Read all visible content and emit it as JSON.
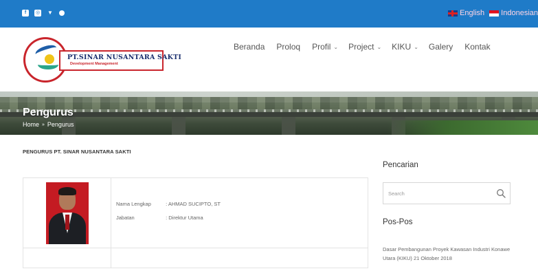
{
  "topbar": {
    "socials": [
      "facebook-icon",
      "instagram-icon",
      "twitter-icon",
      "dribbble-icon"
    ],
    "languages": [
      {
        "label": "English",
        "flag": "uk-flag-icon"
      },
      {
        "label": "Indonesian",
        "flag": "id-flag-icon"
      }
    ]
  },
  "brand": {
    "name": "PT.SINAR NUSANTARA SAKTI",
    "tagline": "Development Management"
  },
  "nav": {
    "items": [
      {
        "label": "Beranda",
        "dropdown": false
      },
      {
        "label": "Proloq",
        "dropdown": false
      },
      {
        "label": "Profil",
        "dropdown": true
      },
      {
        "label": "Project",
        "dropdown": true
      },
      {
        "label": "KIKU",
        "dropdown": true
      },
      {
        "label": "Galery",
        "dropdown": false
      },
      {
        "label": "Kontak",
        "dropdown": false
      }
    ]
  },
  "banner": {
    "title": "Pengurus",
    "breadcrumb": {
      "home": "Home",
      "separator": "»",
      "current": "Pengurus"
    }
  },
  "content": {
    "section_title": "PENGURUS PT. SINAR NUSANTARA SAKTI",
    "member": {
      "name_label": "Nama Lengkap",
      "name_value": ": AHMAD SUCIPTO, ST",
      "role_label": "Jabatan",
      "role_value": ": Direktur Utama"
    }
  },
  "sidebar": {
    "search_heading": "Pencarian",
    "search_placeholder": "Search",
    "posts_heading": "Pos-Pos",
    "posts": [
      {
        "text": "Dasar Pembangunan Proyek Kawasan Industri Konawe Utara (KIKU) 21 Oktober 2018"
      }
    ]
  },
  "colors": {
    "topbar": "#1f7bc8",
    "brand_red": "#c9252c",
    "brand_navy": "#1a2e6e"
  }
}
